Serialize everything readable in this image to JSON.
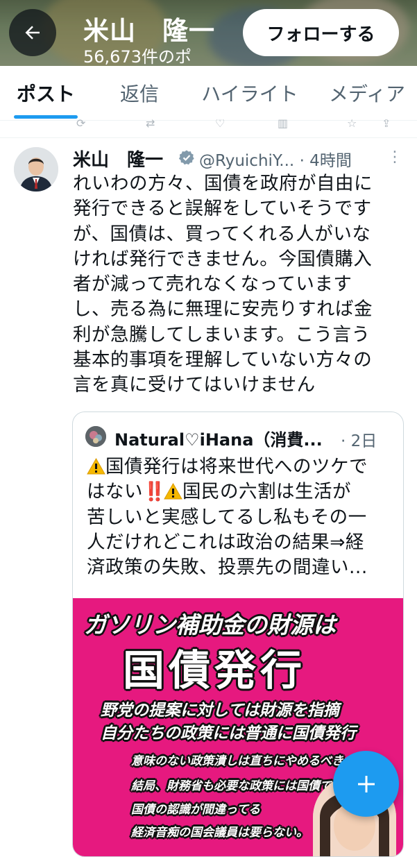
{
  "header": {
    "name": "米山　隆一",
    "post_count": "56,673件のポ",
    "back_icon": "arrow-left-icon",
    "follow_label": "フォローする"
  },
  "tabs": [
    {
      "label": "ポスト",
      "active": true
    },
    {
      "label": "返信",
      "active": false
    },
    {
      "label": "ハイライト",
      "active": false
    },
    {
      "label": "メディア",
      "active": false
    }
  ],
  "tweet": {
    "author": "米山　隆一",
    "handle": "@RyuichiY...",
    "time": "· 4時間",
    "more_icon": "more-vertical-icon",
    "lines": [
      "れいわの方々、国債を政府が自由に",
      "発行できると誤解をしていそうです",
      "が、国債は、買ってくれる人がいな",
      "ければ発行できません。今国債購入",
      "者が減って売れなくなっています",
      "し、売る為に無理に安売りすれば金",
      "利が急騰してしまいます。こう言う",
      "基本的事項を理解していない方々の",
      "言を真に受けてはいけません"
    ]
  },
  "quote": {
    "author": "Natural♡iHana（消費...",
    "time": "· 2日",
    "line1": "国債発行は将来世代へのツケで",
    "line2a": "はない",
    "line2_bang": "‼️",
    "line2b": "国民の六割は生活が",
    "line3": "苦しいと実感してるし私もその一",
    "line4": "人だけれどこれは政治の結果⇒経",
    "line5": "済政策の失敗、投票先の間違い...",
    "image": {
      "title": "ガソリン補助金の財源は",
      "big": "国債発行",
      "sub1": "野党の提案に対しては財源を指摘",
      "sub2": "自分たちの政策には普通に国債発行",
      "t1": "意味のない政策潰しは直ちにやめるべき",
      "t2": "結局、財務省も必要な政策には国債で対",
      "t3": "国債の認識が間違ってる",
      "t4": "経済音痴の国会議員は要らない。"
    }
  },
  "fab_icon": "plus-icon",
  "colors": {
    "accent": "#1d9bf0",
    "image_bg": "#e6197f",
    "text": "#0f1419",
    "muted": "#536471"
  }
}
